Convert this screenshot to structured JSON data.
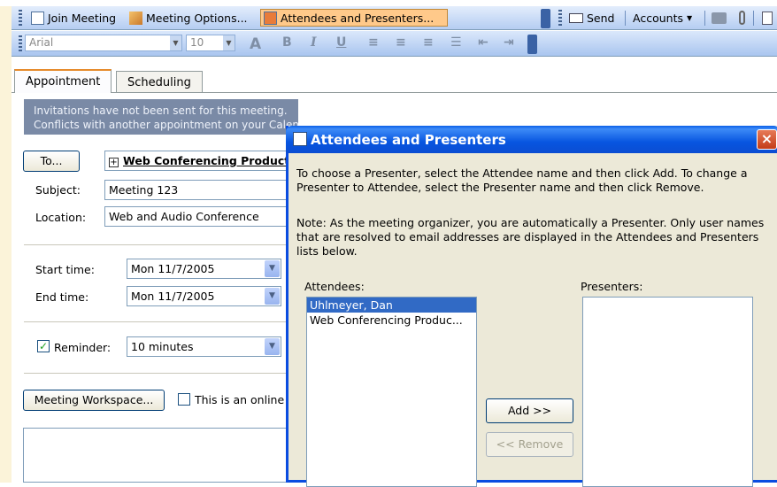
{
  "toolbar": {
    "join_meeting": "Join Meeting",
    "meeting_options": "Meeting Options...",
    "attendees_presenters": "Attendees and Presenters...",
    "send": "Send",
    "accounts": "Accounts",
    "font_name": "Arial",
    "font_size": "10"
  },
  "tabs": {
    "appointment": "Appointment",
    "scheduling": "Scheduling"
  },
  "info": {
    "line1": "Invitations have not been sent for this meeting.",
    "line2": "Conflicts with another appointment on your Calendar."
  },
  "form": {
    "to_button": "To...",
    "to_value": "Web Conferencing Production",
    "subject_label": "Subject:",
    "subject_value": "Meeting 123",
    "location_label": "Location:",
    "location_value": "Web and Audio Conference",
    "start_label": "Start time:",
    "start_value": "Mon 11/7/2005",
    "end_label": "End time:",
    "end_value": "Mon 11/7/2005",
    "reminder_label": "Reminder:",
    "reminder_value": "10 minutes",
    "workspace_button": "Meeting Workspace...",
    "online_label": "This is an online meeting"
  },
  "dialog": {
    "title": "Attendees and Presenters",
    "instructions_1": "To choose a Presenter, select the Attendee name and then click Add. To change a",
    "instructions_2": "Presenter to Attendee, select the Presenter name and then click Remove.",
    "note_1": "Note: As the meeting organizer, you are automatically a Presenter. Only user names",
    "note_2": "that are resolved to email addresses are displayed in the Attendees and Presenters",
    "note_3": "lists below.",
    "attendees_label": "Attendees:",
    "presenters_label": "Presenters:",
    "attendees": [
      "Uhlmeyer, Dan",
      "Web Conferencing Produc..."
    ],
    "add_button": "Add >>",
    "remove_button": "<< Remove"
  },
  "colors": {
    "title_bar": "#0a5fe8",
    "selection": "#316ac5",
    "info_bar": "#7a8aa6",
    "active_button": "#ffc98a"
  }
}
